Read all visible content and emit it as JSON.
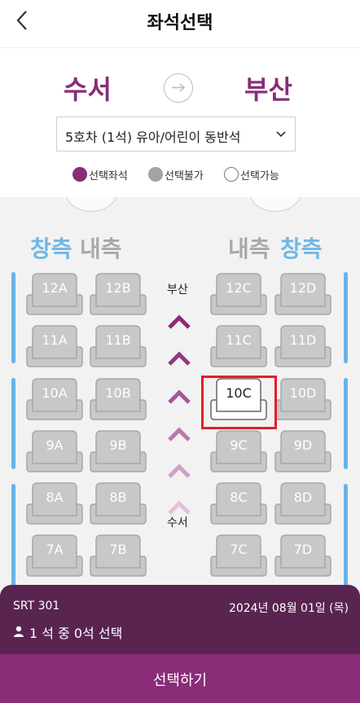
{
  "header": {
    "title": "좌석선택"
  },
  "route": {
    "departure": "수서",
    "arrival": "부산"
  },
  "car_select": {
    "value": "5호차 (1석) 유아/어린이 동반석"
  },
  "legend": [
    {
      "label": "선택좌석",
      "color": "#8a2c77",
      "style": "filled"
    },
    {
      "label": "선택불가",
      "color": "#a3a3a3",
      "style": "filled"
    },
    {
      "label": "선택가능",
      "color": "#ffffff",
      "style": "outline"
    }
  ],
  "seatmap": {
    "left_window": "창측",
    "left_aisle": "내측",
    "right_aisle": "내측",
    "right_window": "창측",
    "direction_top": "부산",
    "direction_bottom": "수서",
    "selected_seat": "10C",
    "rows": [
      {
        "seats": [
          "12A",
          "12B",
          "12C",
          "12D"
        ]
      },
      {
        "seats": [
          "11A",
          "11B",
          "11C",
          "11D"
        ]
      },
      {
        "seats": [
          "10A",
          "10B",
          "10C",
          "10D"
        ]
      },
      {
        "seats": [
          "9A",
          "9B",
          "9C",
          "9D"
        ]
      },
      {
        "seats": [
          "8A",
          "8B",
          "8C",
          "8D"
        ]
      },
      {
        "seats": [
          "7A",
          "7B",
          "7C",
          "7D"
        ]
      }
    ]
  },
  "info": {
    "train": "SRT 301",
    "date": "2024년 08월 01일 (목)",
    "count": "1 석 중 0석 선택"
  },
  "button": {
    "label": "선택하기"
  },
  "colors": {
    "accent": "#8a2c77",
    "panel": "#5a2451",
    "window_blue": "#67b3e8",
    "seat_gray": "#c8c8c8"
  }
}
